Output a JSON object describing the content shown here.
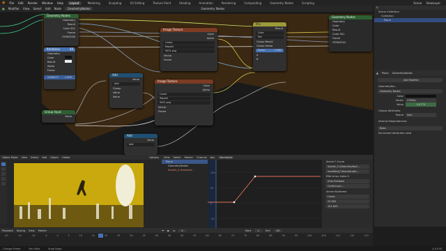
{
  "top_menu": [
    "File",
    "Edit",
    "Render",
    "Window",
    "Help"
  ],
  "workspaces": [
    "Layout",
    "Modeling",
    "Sculpting",
    "UV Editing",
    "Texture Paint",
    "Shading",
    "Animation",
    "Rendering",
    "Compositing",
    "Geometry Nodes",
    "Scripting"
  ],
  "active_workspace": "Layout",
  "scene_label": "Scene",
  "view_layer_label": "ViewLayer",
  "node_editor": {
    "menus": [
      "Modifier",
      "View",
      "Select",
      "Add",
      "Node"
    ],
    "breadcrumb": "GeometryNodes",
    "right_label": "Geometry Nodes"
  },
  "group_input_node": {
    "title": "Geometry Nodes",
    "rows": [
      "Geometry",
      "Result",
      "Color 001",
      "Frame",
      "ITERATION"
    ]
  },
  "iterations_node": {
    "title": "Iterations",
    "value": "48",
    "rows": [
      "Geometry",
      "Color",
      "Result",
      "Alpha",
      "Factor"
    ],
    "footer_left": "2184472",
    "footer_right": "1.000"
  },
  "image_texture_1": {
    "title": "Image Texture",
    "outputs": [
      "Color",
      "Alpha"
    ],
    "interp": "Linear",
    "ext": "Repeat",
    "image": "0001.png",
    "inputs": [
      "Vector",
      "Frame"
    ]
  },
  "image_texture_2": {
    "title": "Image Texture",
    "outputs": [
      "Color",
      "Alpha"
    ],
    "interp": "Linear",
    "ext": "Repeat",
    "image": "0001.png",
    "inputs": [
      "Vector",
      "Frame"
    ]
  },
  "add_node_1": {
    "title": "Add",
    "value": "Value",
    "op": "Add",
    "clamp": "Clamp",
    "rows": [
      "Value",
      "Value"
    ]
  },
  "add_node_2": {
    "title": "Add",
    "value": "Value",
    "op": "Add"
  },
  "group_input_2": {
    "title": "Group Input",
    "value": "Value"
  },
  "mix_node": {
    "title": "Mix",
    "result": "Result",
    "type": "Color",
    "blend": "Mix",
    "clamp_result": "Clamp Result",
    "clamp_factor": "Clamp Factor",
    "factor_label": "Factor",
    "factor_value": "0.862",
    "ab": [
      "A",
      "B"
    ]
  },
  "group_output_node": {
    "title": "Group Output",
    "rows": [
      "Geometry",
      "Color",
      "Result",
      "Color 001",
      "Frame",
      "ITERATION"
    ]
  },
  "outliner": {
    "items": [
      "Scene Collection",
      "Collection",
      "Plane"
    ]
  },
  "properties": {
    "object": "Plane",
    "modifier": "GeometryNodes",
    "add_modifier": "Add Modifier",
    "modifier_name": "GeometryNo...",
    "node_group": "Geometry Nodes",
    "color_label": "Color",
    "vector_label": "Vector",
    "vector_value": "UVMap",
    "value_label": "Value",
    "value_value": "0.4779",
    "output_attributes": "Output Attributes",
    "result_label": "Result",
    "result_value": "lean",
    "internal_deps": "Internal Dependencies",
    "bake": "Bake",
    "no_named": "No named attributes used"
  },
  "image_editor": {
    "menus": [
      "Object Mode",
      "View",
      "Select",
      "Add",
      "Object"
    ],
    "global": "Global",
    "options": "Options"
  },
  "graph_editor": {
    "menus": [
      "View",
      "Select",
      "Marker",
      "Channel",
      "Key"
    ],
    "normalize": "Normalize",
    "channels": [
      "Plane",
      "GeometryNodes",
      "Socket_4 (Geometr...",
      "Socket_4 (GeometryNo..."
    ],
    "y_ticks": [
      "100",
      "50",
      "0",
      "-50",
      "-100"
    ],
    "x_ticks": [
      "0",
      "5",
      "10",
      "15",
      "20",
      "25",
      "30",
      "35",
      "40",
      "45",
      "50",
      "55",
      "60"
    ],
    "fcurve_title": "Active F-Curve",
    "fcurve_name": "Socket_4 (GeometryNod...",
    "fcurve_path": "modifiers[\"GeometryNo...",
    "fcurve_index": "RNA Array Index  0",
    "display_color": "Auto Rainbow",
    "handle_smooth": "Continuous ...",
    "active_keyframe": "Active Keyframe",
    "interpolation": "Linear",
    "key_frame": "20.000",
    "value": "101.849"
  },
  "timeline": {
    "menus": [
      "Playback",
      "Keying",
      "View",
      "Marker"
    ],
    "start_label": "Start",
    "start": "1",
    "end_label": "End",
    "end": "40",
    "current": "4",
    "ticks": [
      "-20",
      "-15",
      "-10",
      "-5",
      "0",
      "5",
      "10",
      "15",
      "20",
      "25",
      "30",
      "35",
      "40",
      "45",
      "50",
      "55",
      "60",
      "65",
      "70",
      "75",
      "80",
      "85",
      "90",
      "95",
      "100",
      "105",
      "110",
      "115",
      "120"
    ]
  },
  "statusbar": {
    "items": [
      "Change Frame",
      "Pan View",
      "Snap Swap"
    ],
    "version": "4.4.0 RC"
  },
  "colors": {
    "accent": "#4772b3",
    "texture_header": "#7c3b22",
    "math_header": "#1f4f72",
    "group_header": "#2d5f33",
    "mix_header": "#9b9b3a",
    "frame_bg": "#3a2812",
    "curve": "#e26d5a"
  }
}
